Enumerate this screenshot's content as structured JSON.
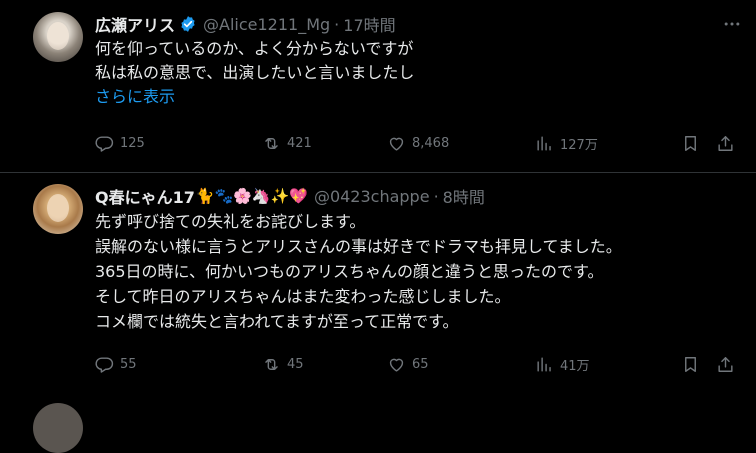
{
  "posts": [
    {
      "name": "広瀬アリス",
      "verified": true,
      "handle": "@Alice1211_Mg",
      "separator": "·",
      "time": "17時間",
      "lines": [
        "何を仰っているのか、よく分からないですが",
        "私は私の意思で、出演したいと言いましたし"
      ],
      "show_more": "さらに表示",
      "stats": {
        "replies": "125",
        "reposts": "421",
        "likes": "8,468",
        "views": "127万"
      }
    },
    {
      "name": "Q春にゃん17",
      "name_emojis": "🐈🐾🌸🦄✨💖",
      "handle": "@0423chappe",
      "separator": "·",
      "time": "8時間",
      "lines": [
        "先ず呼び捨ての失礼をお詫びします。",
        "誤解のない様に言うとアリスさんの事は好きでドラマも拝見してました。",
        "365日の時に、何かいつものアリスちゃんの顔と違うと思ったのです。",
        "そして昨日のアリスちゃんはまた変わった感じしました。",
        "コメ欄では統失と言われてますが至って正常です。"
      ],
      "stats": {
        "replies": "55",
        "reposts": "45",
        "likes": "65",
        "views": "41万"
      }
    }
  ],
  "colors": {
    "background": "#000000",
    "text": "#e7e9ea",
    "muted": "#71767b",
    "link": "#1d9bf0",
    "verified": "#1d9bf0"
  },
  "icons": [
    "more-icon",
    "reply-icon",
    "repost-icon",
    "like-icon",
    "views-icon",
    "bookmark-icon",
    "share-icon",
    "verified-badge-icon"
  ]
}
